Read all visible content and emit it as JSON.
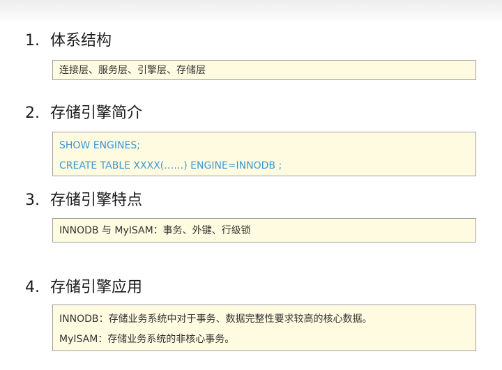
{
  "sections": [
    {
      "number": "1.",
      "title": "体系结构",
      "lines": [
        "连接层、服务层、引擎层、存储层"
      ]
    },
    {
      "number": "2.",
      "title": "存储引擎简介",
      "lines": [
        "SHOW ENGINES;",
        "CREATE TABLE XXXX(……) ENGINE=INNODB ;"
      ]
    },
    {
      "number": "3.",
      "title": "存储引擎特点",
      "lines": [
        "INNODB 与 MyISAM：事务、外键、行级锁"
      ]
    },
    {
      "number": "4.",
      "title": "存储引擎应用",
      "lines": [
        "INNODB：存储业务系统中对于事务、数据完整性要求较高的核心数据。",
        "MyISAM：存储业务系统的非核心事务。"
      ]
    }
  ],
  "colors": {
    "box_background": "#fffbe0",
    "box_border": "#9e9e9e",
    "code_text": "#3a97d4",
    "heading_text": "#1a1a1a",
    "body_text": "#333333"
  }
}
